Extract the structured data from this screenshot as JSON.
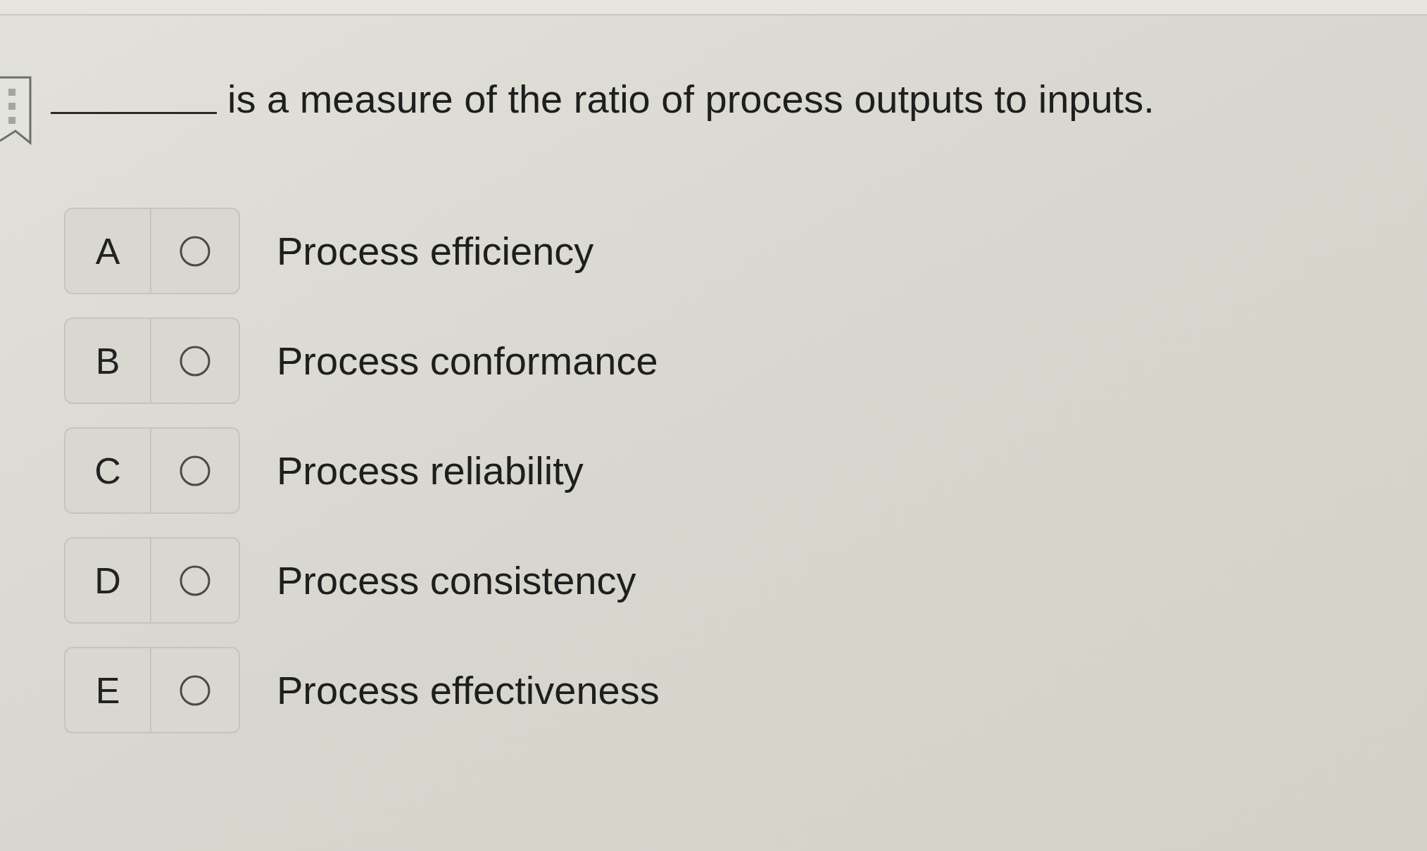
{
  "question": {
    "text": "is a measure of the ratio of process outputs to inputs."
  },
  "options": [
    {
      "letter": "A",
      "label": "Process efficiency",
      "selected": false
    },
    {
      "letter": "B",
      "label": "Process conformance",
      "selected": false
    },
    {
      "letter": "C",
      "label": "Process reliability",
      "selected": false
    },
    {
      "letter": "D",
      "label": "Process consistency",
      "selected": false
    },
    {
      "letter": "E",
      "label": "Process effectiveness",
      "selected": false
    }
  ]
}
